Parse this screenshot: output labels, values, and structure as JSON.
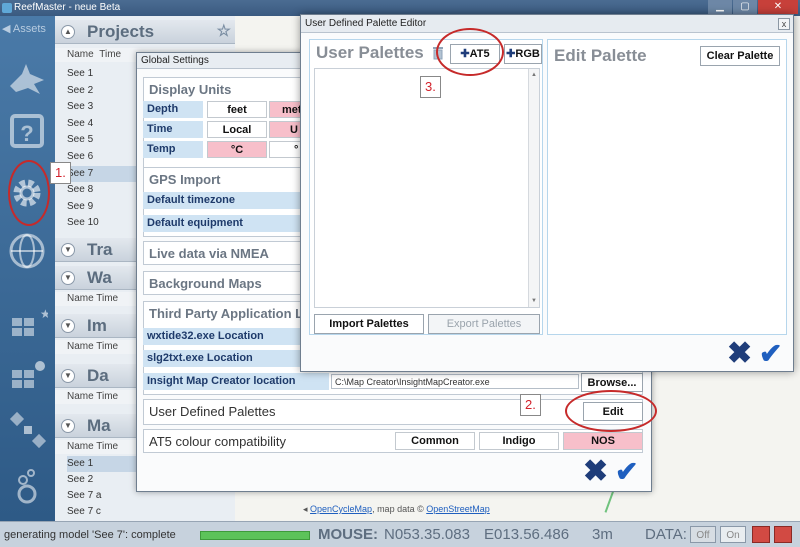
{
  "app": {
    "title": "ReefMaster - neue Beta",
    "win_min": "▁",
    "win_max": "▢",
    "win_close": "✕"
  },
  "sidebar": {
    "assets_label": "◀ Assets",
    "icons": [
      "shark-icon",
      "help-icon",
      "gear-icon",
      "globe-icon",
      "layers-icon",
      "data-icon",
      "satellite-icon",
      "bubbles-icon"
    ]
  },
  "projects": {
    "title": "Projects",
    "col_name": "Name",
    "col_time": "Time",
    "rows": [
      "See 1",
      "See 2",
      "See 3",
      "See 4",
      "See 5",
      "See 6",
      "See 7",
      "See 8",
      "See 9",
      "See 10"
    ],
    "selected_row": "See 7",
    "sub_panels": [
      "Tra",
      "Wa",
      "Im",
      "Da",
      "Ma"
    ],
    "bottom_rows": [
      "See 1",
      "See 2",
      "See 7 a",
      "See 7 c"
    ],
    "name_time": "Name Time"
  },
  "statusbar": {
    "text": "generating model 'See 7': complete",
    "progress": 1.0,
    "mouse_label": "MOUSE:",
    "lat": "N053.35.083",
    "lon": "E013.56.486",
    "scale": "3m",
    "data_label": "DATA:",
    "off": "Off",
    "on": "On"
  },
  "map": {
    "credit_prefix": "◂ ",
    "credit_link1": "OpenCycleMap",
    "credit_mid": ", map data © ",
    "credit_link2": "OpenStreetMap"
  },
  "global_settings": {
    "title": "Global Settings",
    "display_units": "Display Units",
    "depth_label": "Depth",
    "depth_opt1": "feet",
    "depth_opt2": "met",
    "time_label": "Time",
    "time_opt1": "Local",
    "time_opt2": "U",
    "temp_label": "Temp",
    "temp_opt1": "°C",
    "temp_opt2": "°",
    "gps_import": "GPS Import",
    "default_timezone": "Default timezone",
    "default_equipment": "Default equipment",
    "live_data": "Live data via NMEA",
    "background_maps": "Background Maps",
    "third_party": "Third Party Application Lo",
    "wxtide": "wxtide32.exe Location",
    "slg2txt": "slg2txt.exe Location",
    "insight": "Insight Map Creator location",
    "insight_path": "C:\\Map Creator\\InsightMapCreator.exe",
    "browse": "Browse...",
    "user_palettes": "User Defined Palettes",
    "edit": "Edit",
    "at5_compat": "AT5 colour compatibility",
    "common": "Common",
    "indigo": "Indigo",
    "nos": "NOS",
    "cancel_glyph": "✖",
    "ok_glyph": "✔"
  },
  "palette_editor": {
    "title": "User Defined Palette Editor",
    "close": "x",
    "user_palettes": "User Palettes",
    "at5": "AT5",
    "rgb": "RGB",
    "plus": "✚",
    "edit_palette": "Edit Palette",
    "clear_palette": "Clear Palette",
    "import": "Import Palettes",
    "export": "Export Palettes",
    "cancel_glyph": "✖",
    "ok_glyph": "✔"
  },
  "annotations": {
    "step1": "1.",
    "step2": "2.",
    "step3": "3."
  },
  "colors": {
    "accent_blue": "#1f3d7a",
    "pink_selected": "#f7bfca",
    "annotation_red": "#c62a2a"
  }
}
